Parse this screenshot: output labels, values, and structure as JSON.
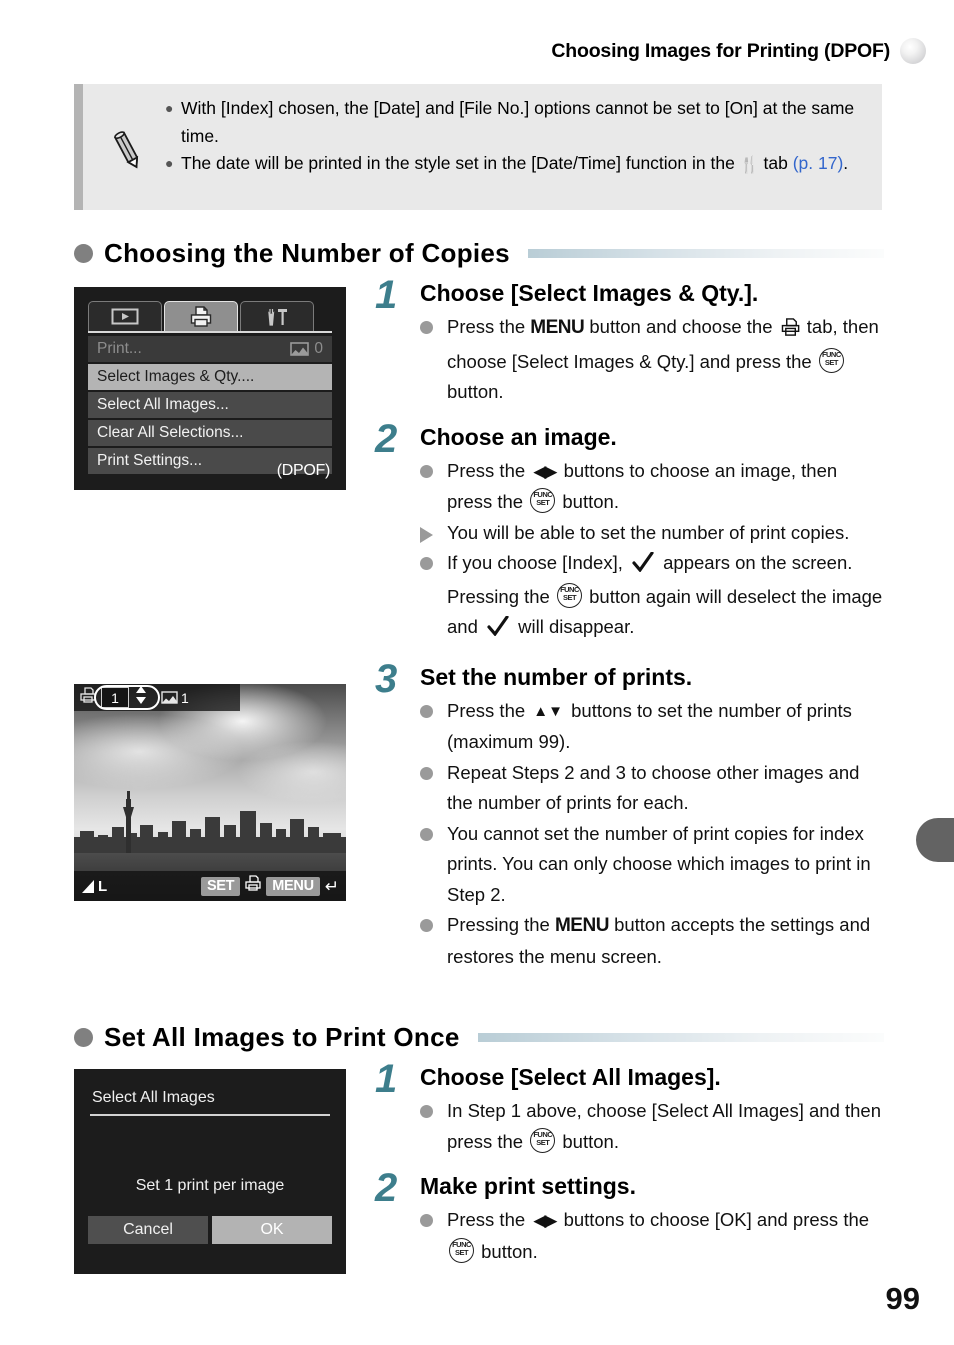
{
  "header": {
    "title": "Choosing Images for Printing (DPOF)",
    "dot_icon": "circle-marker-icon"
  },
  "note": {
    "icon": "pencil-icon",
    "items": [
      {
        "pre": "With [Index] chosen, the [Date] and [File No.] options cannot be set to [On] at the same time.",
        "post": "",
        "link": ""
      },
      {
        "pre": "The date will be printed in the style set in the [Date/Time] function in the",
        "tab_glyph": "settings-tab-icon",
        "mid": "tab",
        "link": "(p. 17)",
        "post": "."
      }
    ]
  },
  "sections": [
    {
      "title": "Choosing the Number of Copies",
      "steps": [
        {
          "num": "1",
          "title": "Choose [Select Images & Qty.].",
          "bullets": [
            {
              "mark": "dot",
              "parts": [
                {
                  "t": "text",
                  "v": "Press the "
                },
                {
                  "t": "menu"
                },
                {
                  "t": "text",
                  "v": " button and choose the "
                },
                {
                  "t": "printicon"
                },
                {
                  "t": "text",
                  "v": " tab, then choose [Select Images & Qty.] and press the "
                },
                {
                  "t": "func"
                },
                {
                  "t": "text",
                  "v": " button."
                }
              ]
            }
          ]
        },
        {
          "num": "2",
          "title": "Choose an image.",
          "bullets": [
            {
              "mark": "dot",
              "parts": [
                {
                  "t": "text",
                  "v": "Press the "
                },
                {
                  "t": "lr"
                },
                {
                  "t": "text",
                  "v": " buttons to choose an image, then press the "
                },
                {
                  "t": "func"
                },
                {
                  "t": "text",
                  "v": " button."
                }
              ]
            },
            {
              "mark": "tri",
              "parts": [
                {
                  "t": "text",
                  "v": "You will be able to set the number of print copies."
                }
              ]
            },
            {
              "mark": "dot",
              "parts": [
                {
                  "t": "text",
                  "v": "If you choose [Index], "
                },
                {
                  "t": "check"
                },
                {
                  "t": "text",
                  "v": " appears on the screen. Pressing the "
                },
                {
                  "t": "func"
                },
                {
                  "t": "text",
                  "v": " button again will deselect the image and "
                },
                {
                  "t": "check"
                },
                {
                  "t": "text",
                  "v": " will disappear."
                }
              ]
            }
          ]
        },
        {
          "num": "3",
          "title": "Set the number of prints.",
          "bullets": [
            {
              "mark": "dot",
              "parts": [
                {
                  "t": "text",
                  "v": "Press the "
                },
                {
                  "t": "ud"
                },
                {
                  "t": "text",
                  "v": " buttons to set the number of prints (maximum 99)."
                }
              ]
            },
            {
              "mark": "dot",
              "parts": [
                {
                  "t": "text",
                  "v": "Repeat Steps 2 and 3 to choose other images and the number of prints for each."
                }
              ]
            },
            {
              "mark": "dot",
              "parts": [
                {
                  "t": "text",
                  "v": "You cannot set the number of print copies for index prints. You can only choose which images to print in Step 2."
                }
              ]
            },
            {
              "mark": "dot",
              "parts": [
                {
                  "t": "text",
                  "v": "Pressing the "
                },
                {
                  "t": "menu"
                },
                {
                  "t": "text",
                  "v": " button accepts the settings and restores the menu screen."
                }
              ]
            }
          ]
        }
      ]
    },
    {
      "title": "Set All Images to Print Once",
      "steps": [
        {
          "num": "1",
          "title": "Choose [Select All Images].",
          "bullets": [
            {
              "mark": "dot",
              "parts": [
                {
                  "t": "text",
                  "v": "In Step 1 above, choose [Select All Images] and then press the "
                },
                {
                  "t": "func"
                },
                {
                  "t": "text",
                  "v": " button."
                }
              ]
            }
          ]
        },
        {
          "num": "2",
          "title": "Make print settings.",
          "bullets": [
            {
              "mark": "dot",
              "parts": [
                {
                  "t": "text",
                  "v": "Press the "
                },
                {
                  "t": "lr"
                },
                {
                  "t": "text",
                  "v": " buttons to choose [OK] and press the "
                },
                {
                  "t": "func"
                },
                {
                  "t": "text",
                  "v": " button."
                }
              ]
            }
          ]
        }
      ]
    }
  ],
  "menu_screen": {
    "tabs": [
      {
        "icon": "playback-tab-icon",
        "active": false
      },
      {
        "icon": "print-tab-icon",
        "active": true
      },
      {
        "icon": "settings-tab-icon",
        "active": false
      }
    ],
    "rows": [
      {
        "label": "Print...",
        "value": "0",
        "value_icon": "print-frame-icon",
        "state": "disabled"
      },
      {
        "label": "Select Images & Qty....",
        "value": "",
        "state": "selected"
      },
      {
        "label": "Select All Images...",
        "value": "",
        "state": "normal"
      },
      {
        "label": "Clear All Selections...",
        "value": "",
        "state": "normal"
      },
      {
        "label": "Print Settings...",
        "value": "",
        "state": "normal"
      }
    ],
    "footer": "(DPOF)"
  },
  "photo_screen": {
    "print_icon": "print-copies-icon",
    "quantity": "1",
    "stepper_icon": "up-down-stepper-icon",
    "total_icon": "total-prints-icon",
    "total": "1",
    "quality_icon": "image-quality-large-icon",
    "quality_label": "L",
    "set_label": "SET",
    "set_action_icon": "print-mark-icon",
    "menu_label": "MENU",
    "menu_action_icon": "return-arrow-icon"
  },
  "dialog_screen": {
    "title": "Select All Images",
    "message": "Set 1 print per image",
    "buttons": [
      {
        "label": "Cancel",
        "active": false
      },
      {
        "label": "OK",
        "active": true
      }
    ]
  },
  "side_tab": {
    "name": "chapter-tab-marker"
  },
  "page_number": "99",
  "colors": {
    "accent_teal": "#3d7e8c",
    "link_blue": "#3366cc",
    "note_bg": "#e9e9e9",
    "note_border": "#b4b4b4",
    "lcd_bg": "#1c1c1c"
  }
}
